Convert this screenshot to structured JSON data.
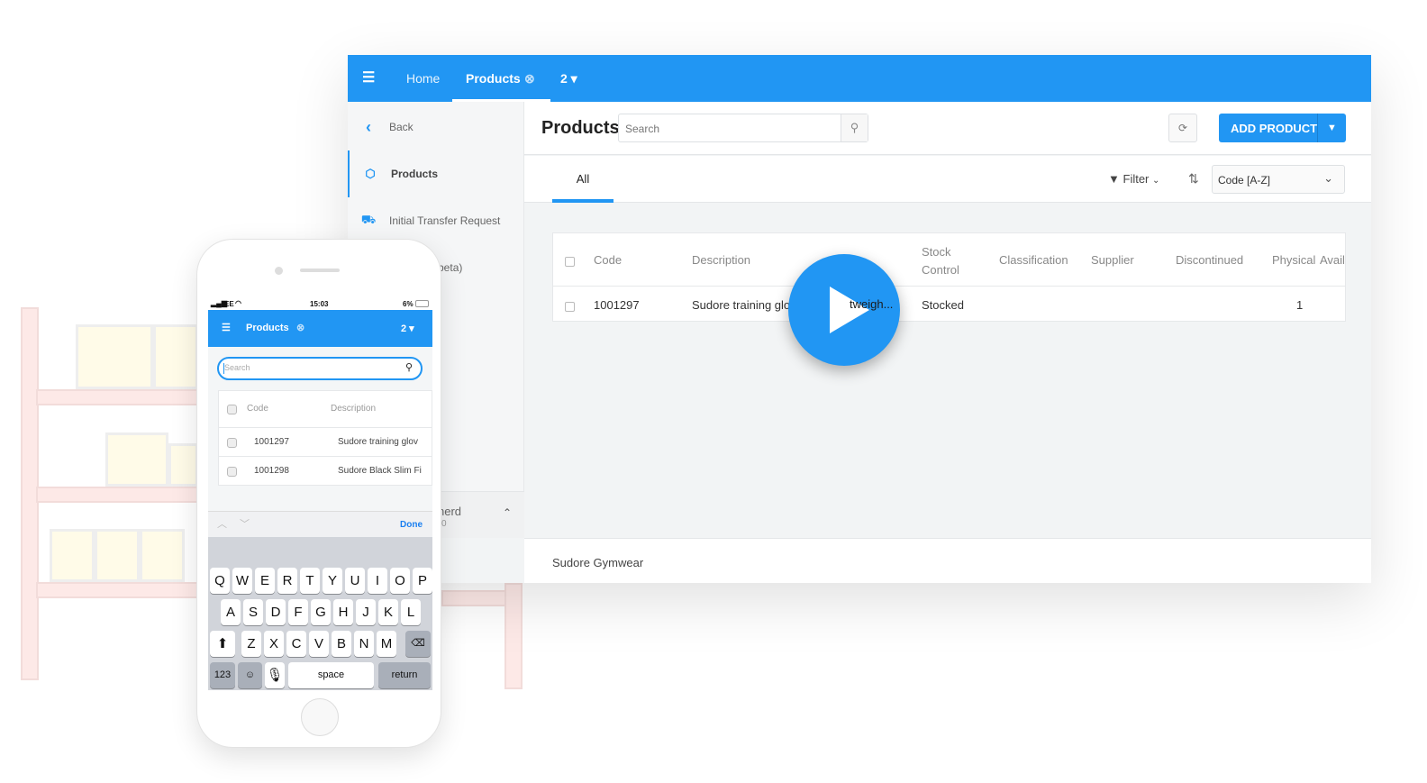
{
  "desktop": {
    "topbar": {
      "menu_icon": "hamburger-icon",
      "home": "Home",
      "products": "Products",
      "window_count": "2 ▾"
    },
    "sidebar": {
      "items": [
        {
          "label": "Back",
          "icon": "chevron-left-icon"
        },
        {
          "label": "Products",
          "icon": "box-icon"
        },
        {
          "label": "Initial Transfer Request",
          "icon": "truck-icon"
        },
        {
          "label": "Forecast (beta)",
          "icon": "chart-icon"
        }
      ],
      "bottom_label": "nerd",
      "bottom_sub": "0"
    },
    "header": {
      "title": "Products",
      "search_placeholder": "Search",
      "add_product": "ADD PRODUCT"
    },
    "tabs": {
      "all": "All",
      "filter": "Filter",
      "sort_value": "Code [A-Z]"
    },
    "table": {
      "headers": [
        "Code",
        "Description",
        "Stock Control",
        "Classification",
        "Supplier",
        "Discontinued",
        "Physical",
        "Availa"
      ],
      "rows": [
        {
          "code": "1001297",
          "description": "Sudore training glov",
          "desc_tail": "tweigh...",
          "stock_control": "Stocked",
          "physical": "1"
        }
      ]
    },
    "footer": {
      "label": "Sudore Gymwear"
    },
    "accent": "#2196f3"
  },
  "phone": {
    "status": {
      "carrier": "EE",
      "time": "15:03",
      "battery": "6%"
    },
    "topbar": {
      "title": "Products",
      "window_count": "2 ▾"
    },
    "search_placeholder": "Search",
    "table": {
      "headers": [
        "Code",
        "Description"
      ],
      "rows": [
        {
          "code": "1001297",
          "description": "Sudore training glov"
        },
        {
          "code": "1001298",
          "description": "Sudore Black Slim Fi"
        }
      ]
    },
    "keyboard": {
      "done": "Done",
      "row1": [
        "Q",
        "W",
        "E",
        "R",
        "T",
        "Y",
        "U",
        "I",
        "O",
        "P"
      ],
      "row2": [
        "A",
        "S",
        "D",
        "F",
        "G",
        "H",
        "J",
        "K",
        "L"
      ],
      "row3": [
        "Z",
        "X",
        "C",
        "V",
        "B",
        "N",
        "M"
      ],
      "num": "123",
      "space": "space",
      "return": "return"
    }
  }
}
